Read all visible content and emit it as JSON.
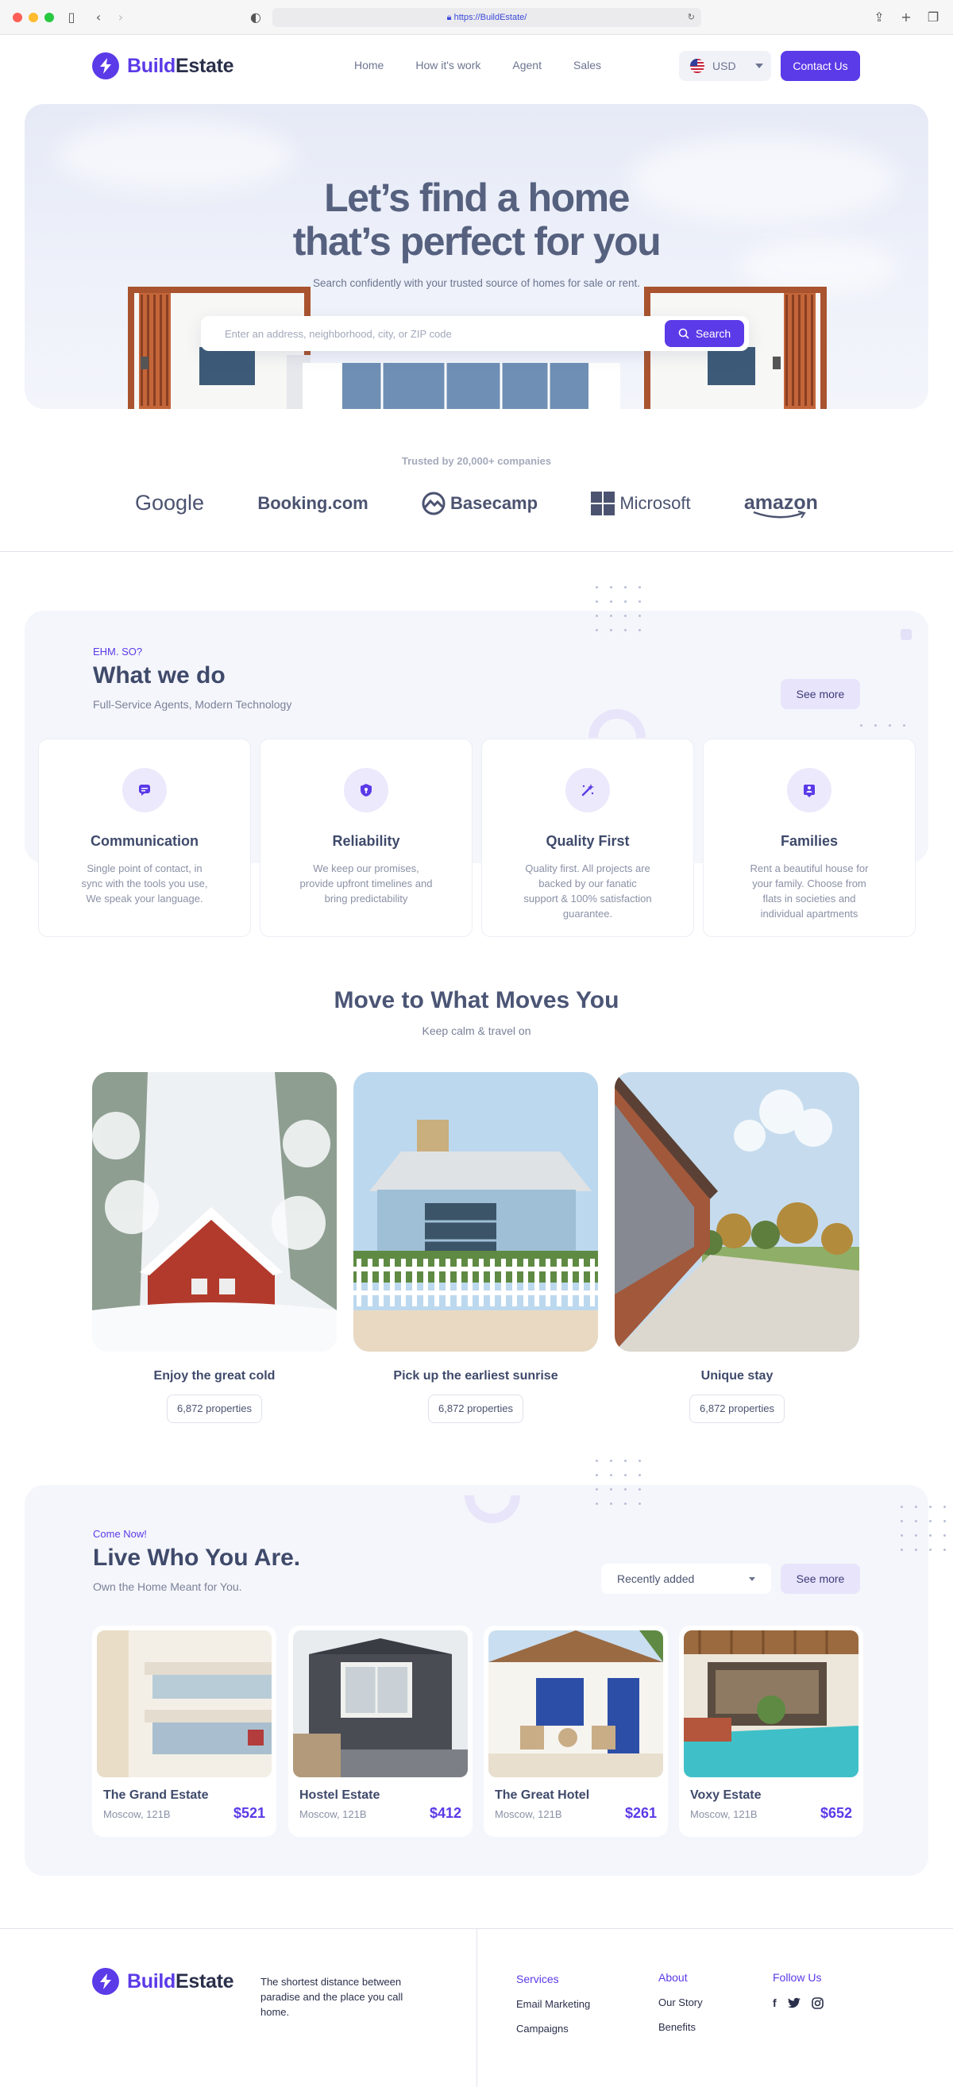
{
  "browser": {
    "url": "https://BuildEstate/"
  },
  "brand": {
    "name_accent": "Build",
    "name_rest": "Estate"
  },
  "nav": {
    "items": [
      "Home",
      "How it's work",
      "Agent",
      "Sales"
    ],
    "currency": "USD",
    "contact": "Contact Us"
  },
  "hero": {
    "title_line1": "Let’s find a home",
    "title_line2": "that’s perfect for you",
    "subtitle": "Search confidently with your trusted source of homes for sale or rent.",
    "search_placeholder": "Enter an address, neighborhood, city, or ZIP code",
    "search_button": "Search"
  },
  "trusted": {
    "text": "Trusted by 20,000+ companies",
    "logos": [
      "Google",
      "Booking.com",
      "Basecamp",
      "Microsoft",
      "amazon"
    ]
  },
  "what_we_do": {
    "eyebrow": "EHM. SO?",
    "title": "What we do",
    "subtitle": "Full-Service Agents, Modern Technology",
    "see_more": "See more",
    "cards": [
      {
        "title": "Communication",
        "desc": "Single point of contact, in sync with the tools you use, We speak your language.",
        "icon": "chat-icon"
      },
      {
        "title": "Reliability",
        "desc": "We keep our promises, provide upfront timelines and bring predictability",
        "icon": "shield-icon"
      },
      {
        "title": "Quality First",
        "desc": "Quality first. All projects are backed by our fanatic support & 100% satisfaction guarantee.",
        "icon": "magic-wand-icon"
      },
      {
        "title": "Families",
        "desc": "Rent a beautiful house for your family. Choose from flats in societies and individual apartments",
        "icon": "family-icon"
      }
    ]
  },
  "moves": {
    "title": "Move to What Moves You",
    "subtitle": "Keep calm & travel on",
    "items": [
      {
        "name": "Enjoy the great cold",
        "count": "6,872",
        "unit": "properties"
      },
      {
        "name": "Pick up the earliest sunrise",
        "count": "6,872",
        "unit": "properties"
      },
      {
        "name": "Unique stay",
        "count": "6,872",
        "unit": "properties"
      }
    ]
  },
  "live": {
    "eyebrow": "Come Now!",
    "title": "Live Who You Are.",
    "subtitle": "Own the Home Meant for You.",
    "sort": "Recently added",
    "see_more": "See more",
    "properties": [
      {
        "name": "The Grand Estate",
        "loc": "Moscow, 121B",
        "price": "$521"
      },
      {
        "name": "Hostel Estate",
        "loc": "Moscow, 121B",
        "price": "$412"
      },
      {
        "name": "The Great Hotel",
        "loc": "Moscow, 121B",
        "price": "$261"
      },
      {
        "name": "Voxy Estate",
        "loc": "Moscow, 121B",
        "price": "$652"
      }
    ]
  },
  "footer": {
    "tagline": "The shortest distance between paradise and the place you call home.",
    "services": {
      "heading": "Services",
      "items": [
        "Email Marketing",
        "Campaigns"
      ]
    },
    "about": {
      "heading": "About",
      "items": [
        "Our Story",
        "Benefits"
      ]
    },
    "follow": {
      "heading": "Follow Us",
      "icons": [
        "facebook-icon",
        "twitter-icon",
        "instagram-icon"
      ]
    }
  },
  "colors": {
    "accent": "#5b3ae8",
    "text": "#3f4a6b",
    "muted": "#7a8299",
    "soft_bg": "#f5f6fb"
  }
}
